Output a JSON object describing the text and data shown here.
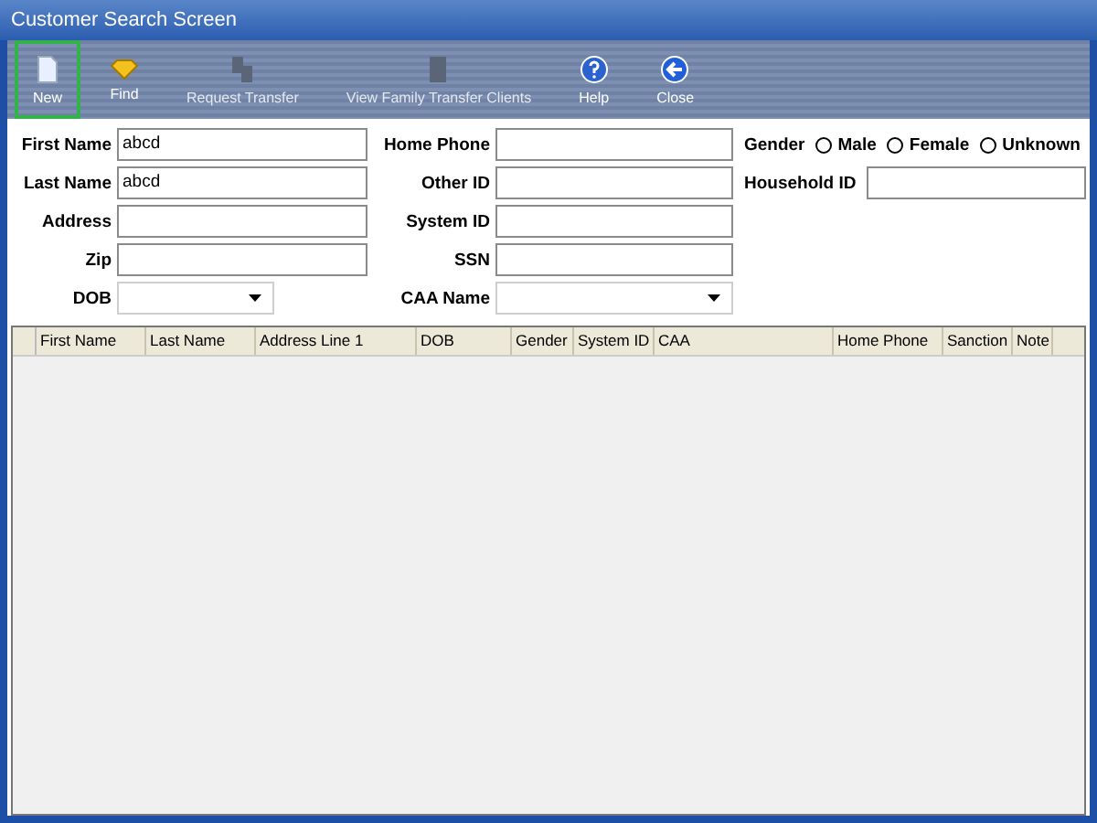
{
  "window": {
    "title": "Customer Search Screen"
  },
  "toolbar": [
    {
      "label": "New",
      "kind": "page",
      "selected": true,
      "disabled": false
    },
    {
      "label": "Find",
      "kind": "find",
      "selected": false,
      "disabled": false
    },
    {
      "label": "Request Transfer",
      "kind": "transfer",
      "selected": false,
      "disabled": true
    },
    {
      "label": "View Family Transfer Clients",
      "kind": "family",
      "selected": false,
      "disabled": true
    },
    {
      "label": "Help",
      "kind": "help",
      "selected": false,
      "disabled": false
    },
    {
      "label": "Close",
      "kind": "close",
      "selected": false,
      "disabled": false
    }
  ],
  "form": {
    "rows": [
      [
        {
          "label": "First Name",
          "value": "abcd",
          "kind": "text"
        },
        {
          "label": "Home Phone",
          "kind": "text"
        }
      ],
      [
        {
          "label": "Last Name",
          "value": "abcd",
          "kind": "text"
        },
        {
          "label": "Other ID",
          "kind": "text"
        }
      ],
      [
        {
          "label": "Address",
          "kind": "text"
        },
        {
          "label": "System ID",
          "kind": "text"
        }
      ],
      [
        {
          "label": "Zip",
          "kind": "text"
        },
        {
          "label": "SSN",
          "kind": "text"
        }
      ],
      [
        {
          "label": "DOB",
          "kind": "dropdown"
        },
        {
          "label": "CAA Name",
          "kind": "dropdown"
        }
      ]
    ],
    "gender": {
      "label": "Gender",
      "options": [
        {
          "label": "Male",
          "selected": false
        },
        {
          "label": "Female",
          "selected": false
        },
        {
          "label": "Unknown",
          "selected": false
        }
      ]
    },
    "household": {
      "label": "Household ID"
    }
  },
  "table": {
    "columns": [
      "First Name",
      "Last Name",
      "Address Line 1",
      "DOB",
      "Gender",
      "System ID",
      "CAA",
      "Home Phone",
      "Sanction",
      "Note"
    ]
  }
}
